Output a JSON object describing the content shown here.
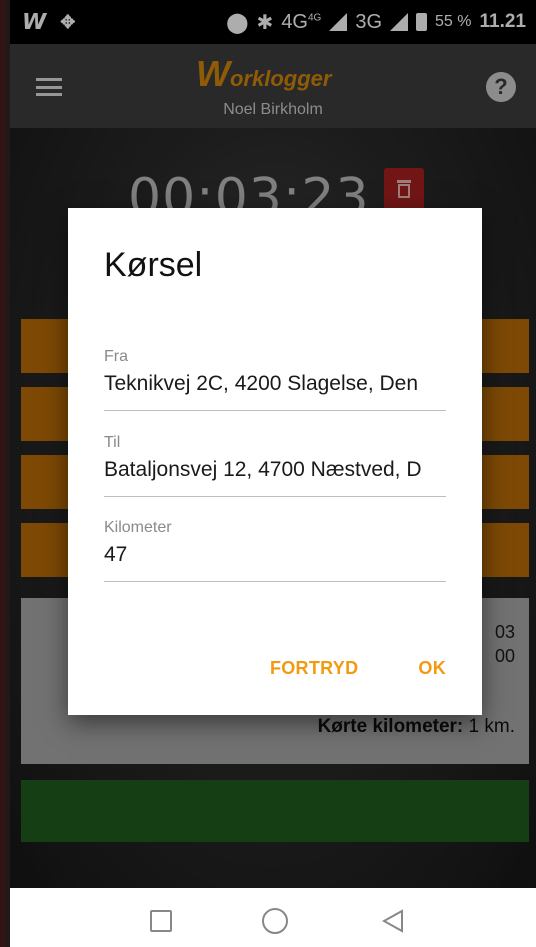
{
  "status_bar": {
    "left_icons": [
      "worklogger-icon",
      "dropbox-icon"
    ],
    "network_1": "4G",
    "network_1_sup": "4G",
    "network_2": "3G",
    "battery": "55 %",
    "time": "11.21"
  },
  "app_bar": {
    "logo_first": "W",
    "logo_rest": "orklogger",
    "user_name": "Noel Birkholm",
    "help_label": "?"
  },
  "background": {
    "timer": "00:03:23",
    "info_line_1": "03",
    "info_line_2": "00",
    "km_label": "Kørte kilometer:",
    "km_value": " 1 km."
  },
  "dialog": {
    "title": "Kørsel",
    "fields": [
      {
        "label": "Fra",
        "value": "Teknikvej 2C, 4200 Slagelse, Den"
      },
      {
        "label": "Til",
        "value": "Bataljonsvej 12, 4700 Næstved, D"
      },
      {
        "label": "Kilometer",
        "value": "47"
      }
    ],
    "cancel_label": "FORTRYD",
    "ok_label": "OK"
  },
  "colors": {
    "accent": "#f29a10",
    "logo": "#d4860a",
    "delete": "#a82020",
    "success": "#1f5c1f"
  }
}
